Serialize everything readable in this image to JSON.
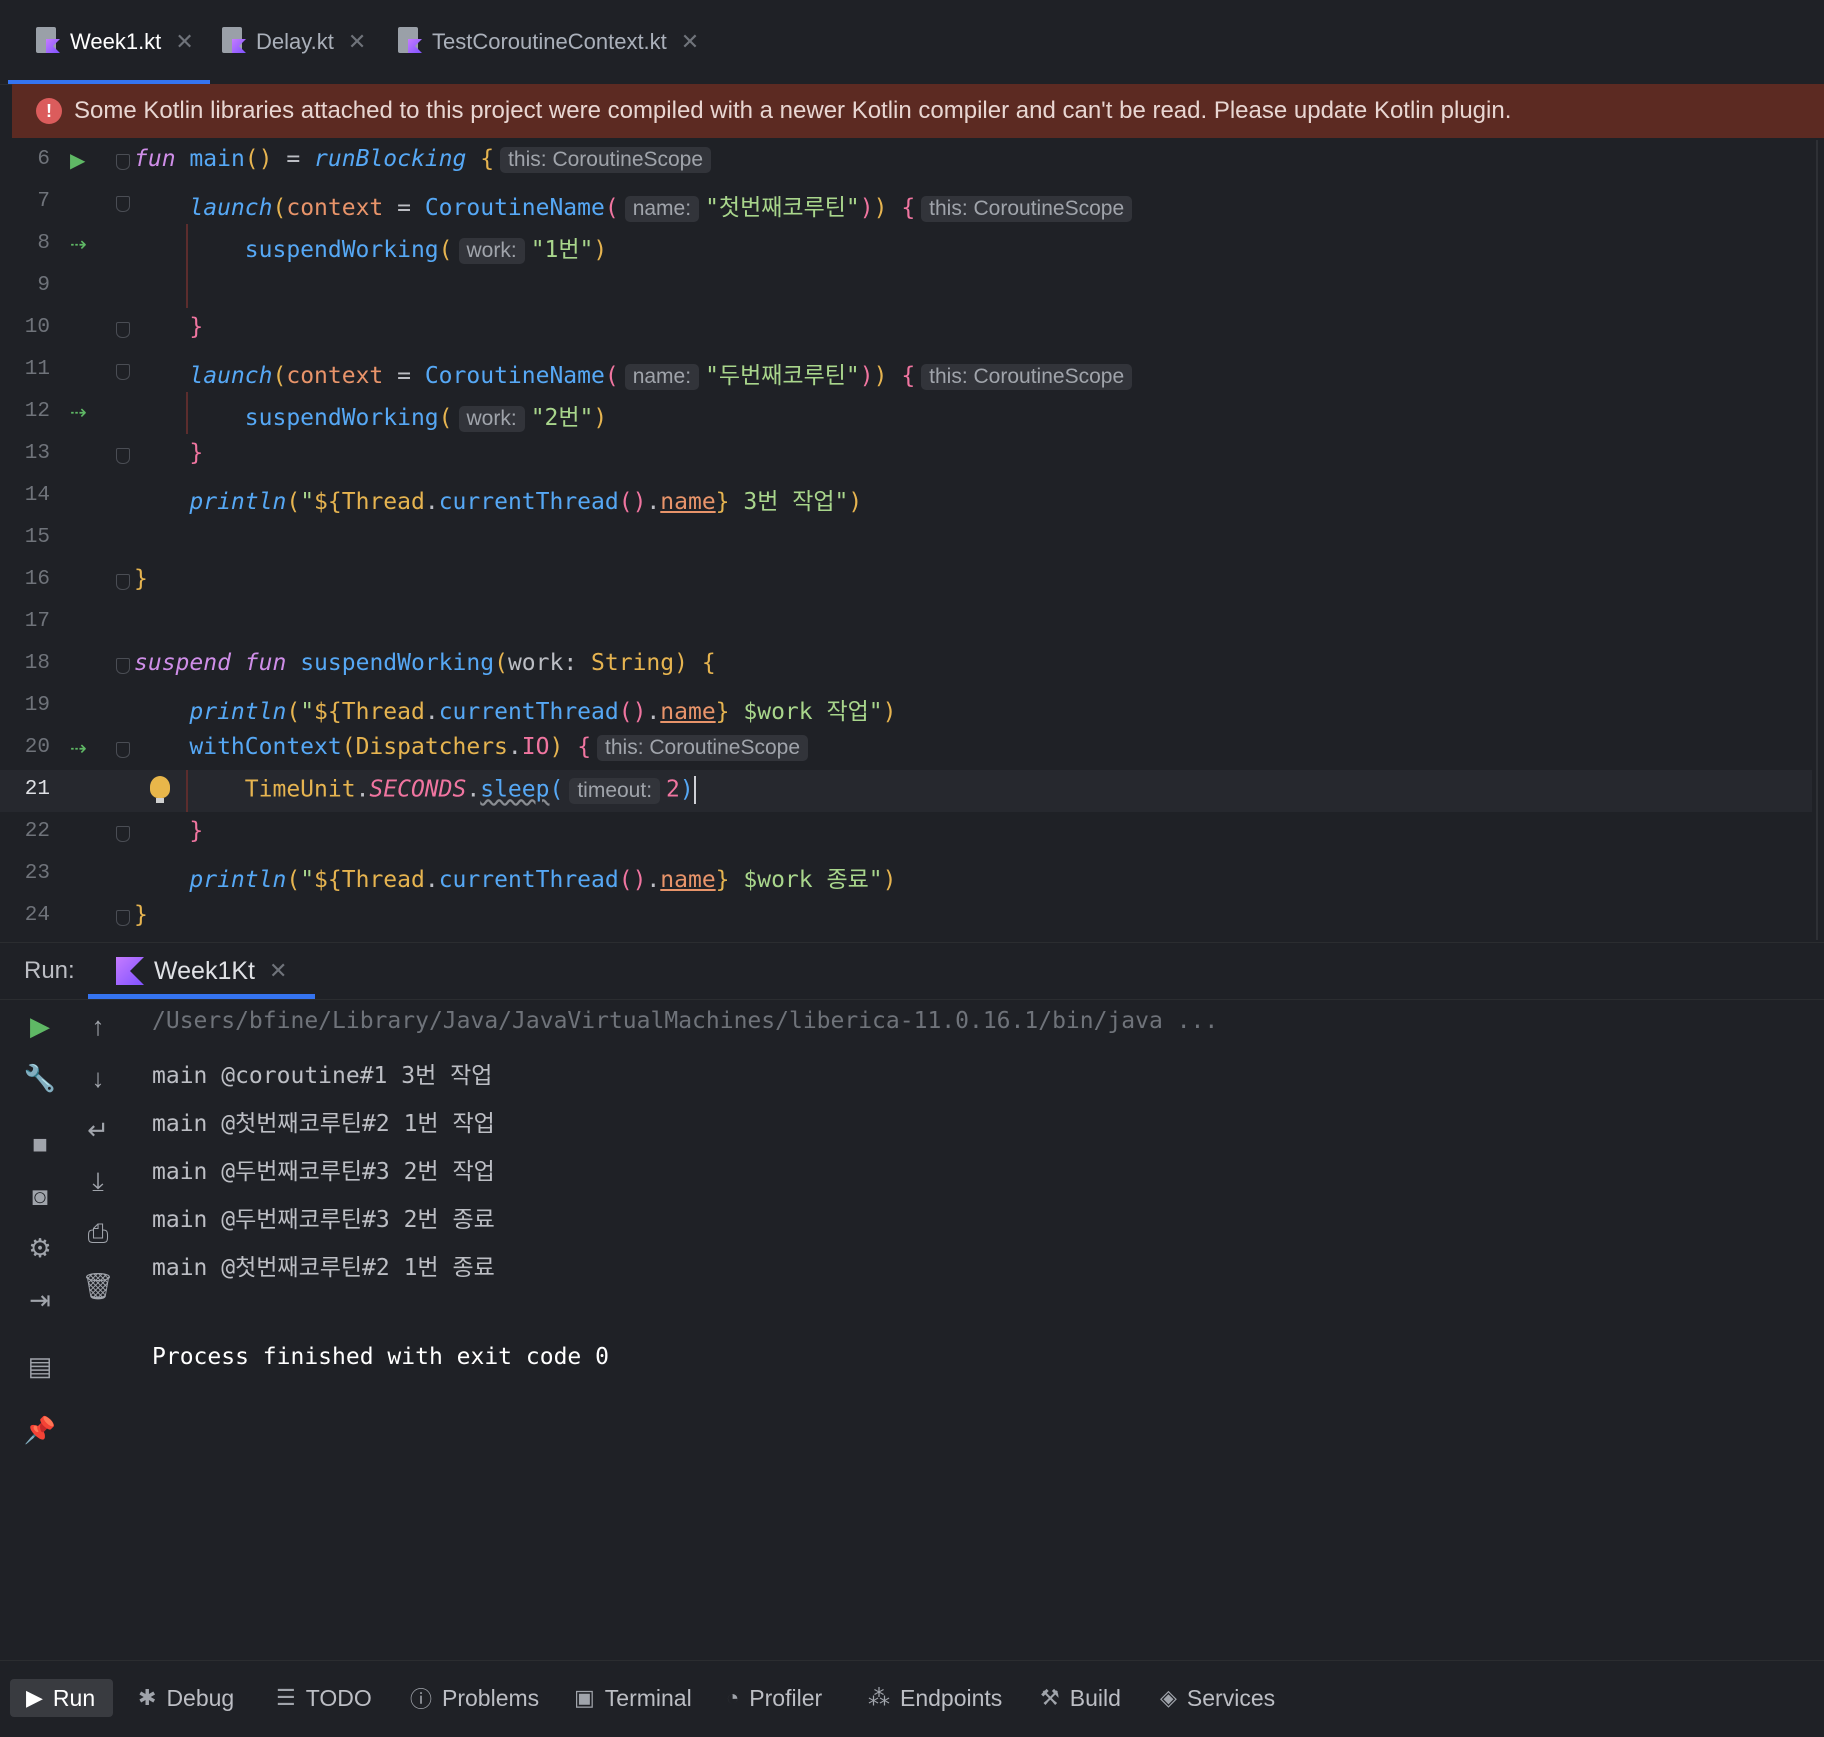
{
  "tabs": [
    {
      "label": "Week1.kt",
      "active": true
    },
    {
      "label": "Delay.kt",
      "active": false
    },
    {
      "label": "TestCoroutineContext.kt",
      "active": false
    }
  ],
  "banner": {
    "text": "Some Kotlin libraries attached to this project were compiled with a newer Kotlin compiler and can't be read. Please update Kotlin plugin."
  },
  "editor": {
    "line_numbers": [
      "6",
      "7",
      "8",
      "9",
      "10",
      "11",
      "12",
      "13",
      "14",
      "15",
      "16",
      "17",
      "18",
      "19",
      "20",
      "21",
      "22",
      "23",
      "24"
    ],
    "current_line": "21",
    "hints": {
      "coroutine_scope": "this: CoroutineScope",
      "name": "name:",
      "work": "work:",
      "timeout": "timeout:"
    },
    "strings": {
      "first_coroutine": "\"첫번째코루틴\"",
      "second_coroutine": "\"두번째코루틴\"",
      "work1": "\"1번\"",
      "work2": "\"2번\""
    }
  },
  "run_panel": {
    "label": "Run:",
    "tab": "Week1Kt",
    "console": [
      "/Users/bfine/Library/Java/JavaVirtualMachines/liberica-11.0.16.1/bin/java ...",
      "main @coroutine#1 3번 작업",
      "main @첫번째코루틴#2 1번 작업",
      "main @두번째코루틴#3 2번 작업",
      "main @두번째코루틴#3 2번 종료",
      "main @첫번째코루틴#2 1번 종료",
      "Process finished with exit code 0"
    ]
  },
  "bottom_bar": [
    {
      "label": "Run",
      "icon": "play-icon",
      "active": true
    },
    {
      "label": "Debug",
      "icon": "bug-icon"
    },
    {
      "label": "TODO",
      "icon": "list-icon"
    },
    {
      "label": "Problems",
      "icon": "problems-icon"
    },
    {
      "label": "Terminal",
      "icon": "terminal-icon"
    },
    {
      "label": "Profiler",
      "icon": "profiler-icon"
    },
    {
      "label": "Endpoints",
      "icon": "endpoints-icon"
    },
    {
      "label": "Build",
      "icon": "hammer-icon"
    },
    {
      "label": "Services",
      "icon": "services-icon"
    }
  ],
  "colors": {
    "accent": "#3574f0",
    "banner_bg": "#5c2a22",
    "background": "#1f2126"
  }
}
